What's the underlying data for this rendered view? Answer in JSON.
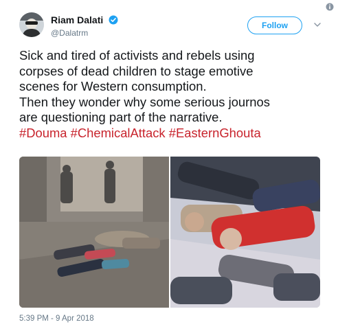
{
  "author": {
    "display_name": "Riam Dalati",
    "handle": "@Dalatrm",
    "verified": true
  },
  "follow_label": "Follow",
  "tweet": {
    "lines": [
      "Sick and tired of activists and rebels using",
      "corpses of dead children to stage emotive",
      "scenes for Western consumption.",
      "Then they wonder why some serious journos",
      "are questioning part of the narrative."
    ],
    "hashtags": [
      "#Douma",
      "#ChemicalAttack",
      "#EasternGhouta"
    ]
  },
  "media": {
    "photo_count": 2
  },
  "timestamp": "5:39 PM - 9 Apr 2018",
  "colors": {
    "accent": "#1da1f2",
    "hashtag": "#c8232c",
    "secondary_text": "#657786",
    "primary_text": "#14171a"
  },
  "icons": [
    "info-icon",
    "verified-icon",
    "chevron-down-icon"
  ]
}
